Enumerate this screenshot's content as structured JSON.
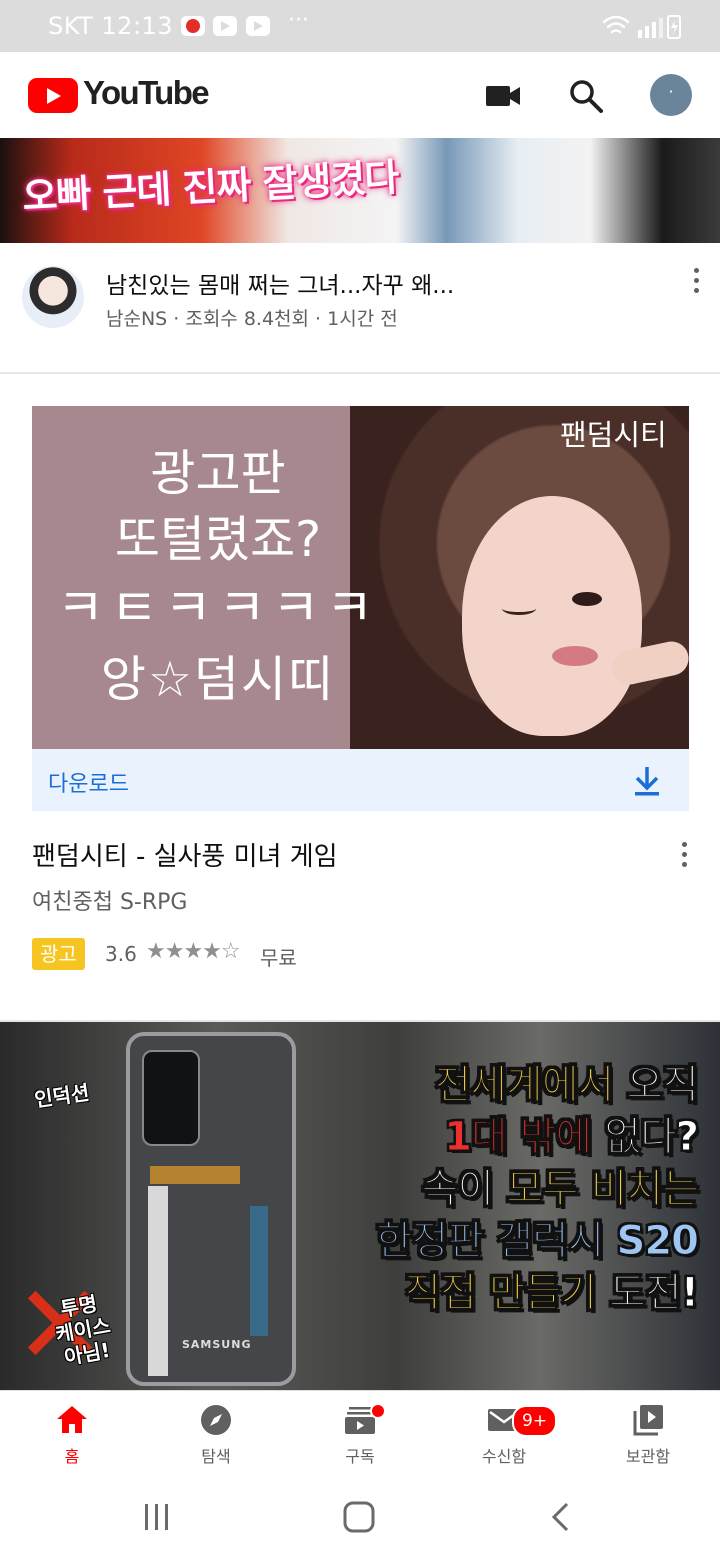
{
  "status_bar": {
    "carrier_time": "SKT 12:13",
    "more": "···"
  },
  "header": {
    "logo_text": "YouTube",
    "avatar_initial": "·"
  },
  "feed": {
    "video1": {
      "thumbnail_caption": "오빠 근데 진짜 잘생겼다",
      "title": "남친있는 몸매 쩌는 그녀...자꾸 왜...",
      "meta": "남순NS · 조회수 8.4천회 · 1시간 전"
    },
    "ad": {
      "brand_watermark": "팬덤시티",
      "image_text": [
        "광고판",
        "또털렸죠?",
        "ㅋㅌㅋㅋㅋㅋ",
        "앙☆덤시띠"
      ],
      "download_label": "다운로드",
      "title": "팬덤시티 - 실사풍 미녀 게임",
      "subtitle": "여친중첩 S-RPG",
      "badge": "광고",
      "rating": "3.6",
      "stars": "★★★★☆",
      "price": "무료"
    },
    "video3": {
      "sticker_induction": "인덕션",
      "sticker_not_case": "투명\n케이스\n아님!",
      "phone_brand": "SAMSUNG",
      "headline": [
        [
          "전세계에서 ",
          "오직"
        ],
        [
          "1대 밖에 ",
          "없다?"
        ],
        [
          "속이 ",
          "모두 비치는"
        ],
        [
          "한정판 갤럭시 S20"
        ],
        [
          "직접 만들기 ",
          "도전!"
        ]
      ]
    }
  },
  "bottom_nav": {
    "items": [
      {
        "label": "홈",
        "icon": "home-icon"
      },
      {
        "label": "탐색",
        "icon": "explore-icon"
      },
      {
        "label": "구독",
        "icon": "subscriptions-icon"
      },
      {
        "label": "수신함",
        "icon": "inbox-icon"
      },
      {
        "label": "보관함",
        "icon": "library-icon"
      }
    ],
    "inbox_badge": "9+"
  },
  "colors": {
    "brand_red": "#ff0000",
    "link_blue": "#1a6ed8",
    "ad_yellow": "#f7c522"
  }
}
